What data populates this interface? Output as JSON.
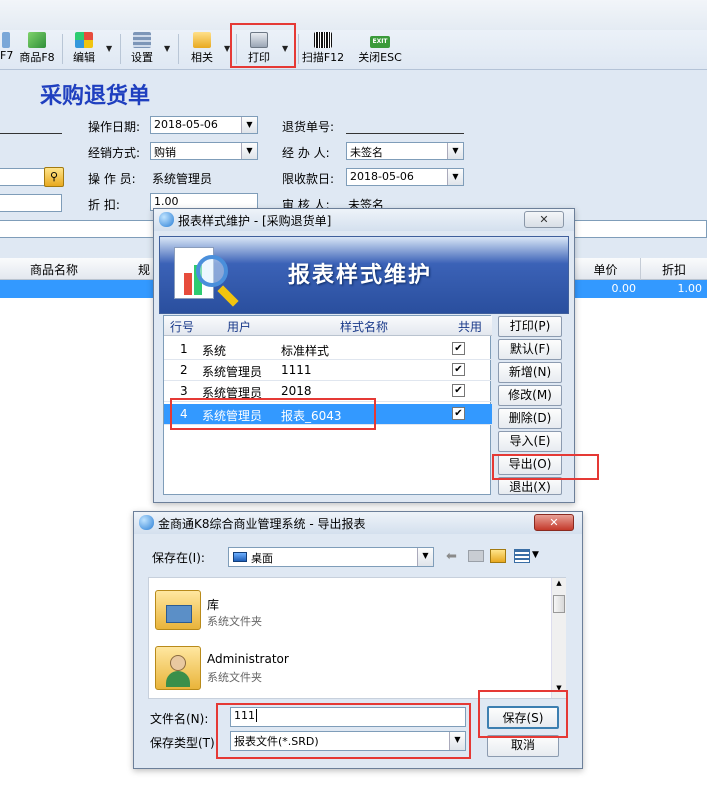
{
  "toolbar": {
    "items": [
      {
        "label": "F7"
      },
      {
        "label": "商品F8"
      },
      {
        "label": "编辑"
      },
      {
        "label": "设置"
      },
      {
        "label": "相关"
      },
      {
        "label": "打印"
      },
      {
        "label": "扫描F12"
      },
      {
        "label": "关闭ESC"
      }
    ],
    "exit_icon_text": "EXIT"
  },
  "form": {
    "title": "采购退货单",
    "op_date_label": "操作日期:",
    "op_date_value": "2018-05-06",
    "return_no_label": "退货单号:",
    "sale_mode_label": "经销方式:",
    "sale_mode_value": "购销",
    "handler_label": "经 办 人:",
    "handler_value": "未签名",
    "operator_label": "操 作 员:",
    "operator_value": "系统管理员",
    "deadline_label": "限收款日:",
    "deadline_value": "2018-05-06",
    "discount_label": "折    扣:",
    "discount_value": "1.00",
    "auditor_label": "审 核 人:",
    "auditor_value": "未签名"
  },
  "grid": {
    "headers": [
      "商品名称",
      "规",
      "单价",
      "折扣"
    ],
    "row": {
      "price": "0.00",
      "discount": "1.00"
    }
  },
  "report_dialog": {
    "title": "报表样式维护 - [采购退货单]",
    "banner": "报表样式维护",
    "columns": [
      "行号",
      "用户",
      "样式名称",
      "共用"
    ],
    "rows": [
      {
        "no": "1",
        "user": "系统",
        "name": "标准样式",
        "shared": "✔"
      },
      {
        "no": "2",
        "user": "系统管理员",
        "name": "1111",
        "shared": "✔"
      },
      {
        "no": "3",
        "user": "系统管理员",
        "name": "2018",
        "shared": "✔"
      },
      {
        "no": "4",
        "user": "系统管理员",
        "name": "报表_6043",
        "shared": "✔"
      }
    ],
    "buttons": [
      "打印(P)",
      "默认(F)",
      "新增(N)",
      "修改(M)",
      "删除(D)",
      "导入(E)",
      "导出(O)",
      "退出(X)"
    ]
  },
  "export_dialog": {
    "title": "金商通K8综合商业管理系统 - 导出报表",
    "save_in_label": "保存在(I):",
    "save_in_value": "桌面",
    "items": [
      {
        "name": "库",
        "type": "系统文件夹"
      },
      {
        "name": "Administrator",
        "type": "系统文件夹"
      }
    ],
    "filename_label": "文件名(N):",
    "filename_value": "111",
    "filetype_label": "保存类型(T):",
    "filetype_value": "报表文件(*.SRD)",
    "save_button": "保存(S)",
    "cancel_button": "取消"
  }
}
